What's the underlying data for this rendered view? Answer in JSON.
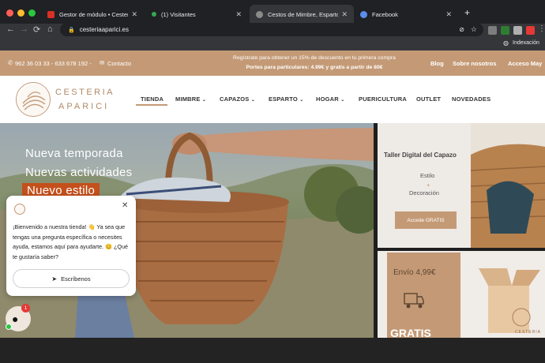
{
  "browser": {
    "tabs": [
      {
        "title": "Gestor de módulo • Cestería A",
        "favicon_color": "#d93025"
      },
      {
        "title": "(1) Visitantes",
        "favicon_color": "#34a853"
      },
      {
        "title": "Cestos de Mimbre, Esparto y P",
        "favicon_color": "#8a8a8a"
      },
      {
        "title": "Facebook",
        "favicon_color": "#5b8def"
      }
    ],
    "new_tab": "+",
    "url": "cesteriaaparici.es",
    "extension_label": "Indexación"
  },
  "topbar": {
    "phone": "962 36 03 33 - 633 678 192 -",
    "contact": "Contacto",
    "promo_line1": "Regístrate para obtener un 15% de descuento en tu primera compra",
    "promo_line2": "Portes para particulares: 4.99€ y gratis a partir de 80€",
    "links": [
      "Blog",
      "Sobre nosotros",
      "Acceso May"
    ]
  },
  "header": {
    "logo_line1": "CESTERIA",
    "logo_line2": "APARICI",
    "nav": [
      {
        "label": "TIENDA",
        "dropdown": false
      },
      {
        "label": "MIMBRE",
        "dropdown": true
      },
      {
        "label": "CAPAZOS",
        "dropdown": true
      },
      {
        "label": "ESPARTO",
        "dropdown": true
      },
      {
        "label": "HOGAR",
        "dropdown": true
      },
      {
        "label": "PUERICULTURA",
        "dropdown": false
      },
      {
        "label": "OUTLET",
        "dropdown": false
      },
      {
        "label": "NOVEDADES",
        "dropdown": false
      }
    ]
  },
  "hero": {
    "line1": "Nueva temporada",
    "line2": "Nuevas actividades",
    "line3": "Nuevo estilo"
  },
  "side1": {
    "title": "Taller Digital del Capazo",
    "item1": "Estilo",
    "plus": "+",
    "item2": "Decoración",
    "button": "Accede GRATIS"
  },
  "side2": {
    "title": "Envío 4,99€",
    "big": "GRATIS",
    "box_label": "CESTERIA"
  },
  "chat": {
    "message": "¡Bienvenido a nuestra tienda! 👋 Ya sea que tengas una pregunta específica o necesites ayuda, estamos aquí para ayudarte. 😊 ¿Qué te gustaría saber?",
    "button": "Escríbenos",
    "badge": "1"
  }
}
